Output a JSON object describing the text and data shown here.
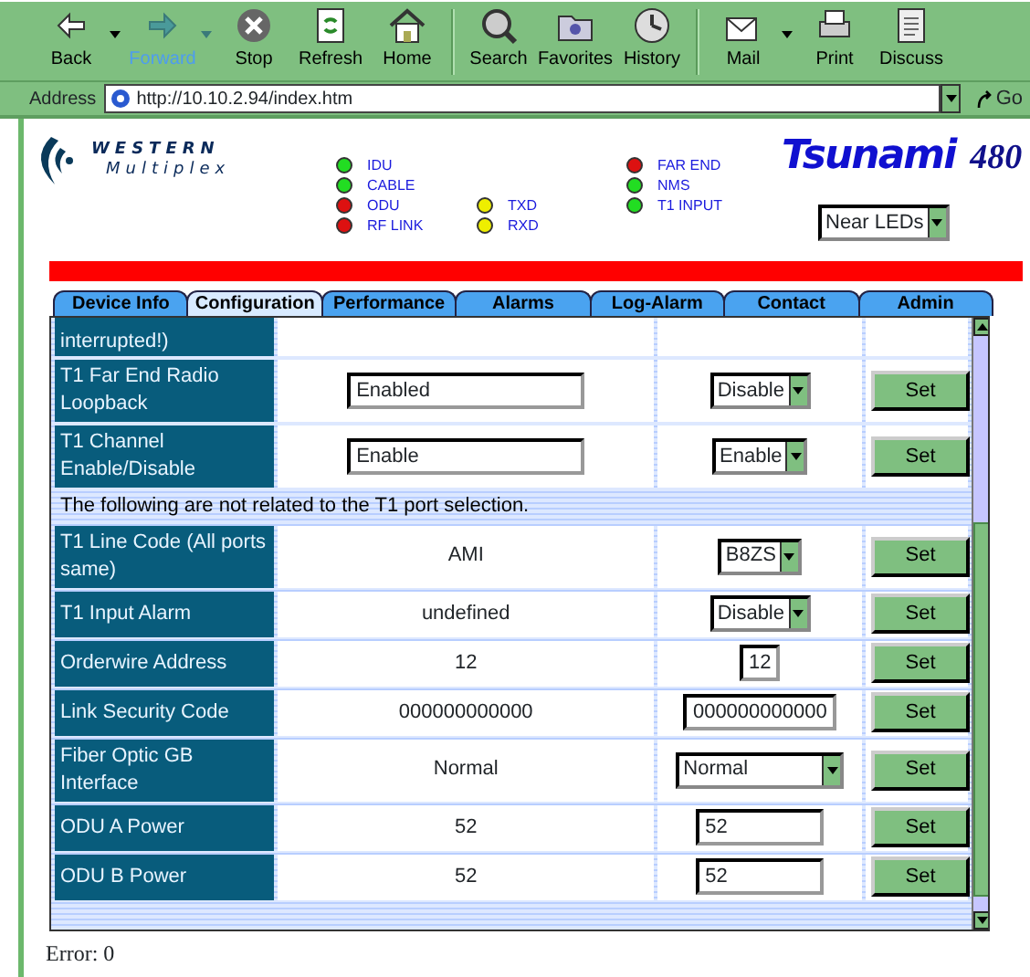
{
  "toolbar": [
    {
      "label": "Back",
      "disabled": false,
      "dropdown": true
    },
    {
      "label": "Forward",
      "disabled": true,
      "dropdown": true
    },
    {
      "label": "Stop",
      "disabled": false,
      "dropdown": false
    },
    {
      "label": "Refresh",
      "disabled": false,
      "dropdown": false
    },
    {
      "label": "Home",
      "disabled": false,
      "dropdown": false
    },
    {
      "label": "Search",
      "disabled": false,
      "dropdown": false
    },
    {
      "label": "Favorites",
      "disabled": false,
      "dropdown": false
    },
    {
      "label": "History",
      "disabled": false,
      "dropdown": false
    },
    {
      "label": "Mail",
      "disabled": false,
      "dropdown": true
    },
    {
      "label": "Print",
      "disabled": false,
      "dropdown": false
    },
    {
      "label": "Discuss",
      "disabled": false,
      "dropdown": false
    }
  ],
  "address_bar": {
    "label": "Address",
    "url": "http://10.10.2.94/index.htm",
    "go": "Go"
  },
  "logo": {
    "line_1": "WESTERN",
    "line_2": "Multiplex"
  },
  "product": {
    "name": "Tsunami",
    "model": "480"
  },
  "led_groups": [
    [
      {
        "label": "IDU",
        "color": "#22dd22"
      },
      {
        "label": "CABLE",
        "color": "#22dd22"
      },
      {
        "label": "ODU",
        "color": "#dd1111"
      },
      {
        "label": "RF LINK",
        "color": "#dd1111"
      }
    ],
    [
      {
        "label": "TXD",
        "color": "#eeee00"
      },
      {
        "label": "RXD",
        "color": "#eeee00"
      }
    ],
    [
      {
        "label": "FAR END",
        "color": "#dd1111"
      },
      {
        "label": "NMS",
        "color": "#22dd22"
      },
      {
        "label": "T1 INPUT",
        "color": "#22dd22"
      }
    ]
  ],
  "led_select": "Near LEDs",
  "tabs": [
    {
      "label": "Device Info",
      "selected": false
    },
    {
      "label": "Configuration",
      "selected": true
    },
    {
      "label": "Performance",
      "selected": false
    },
    {
      "label": "Alarms",
      "selected": false
    },
    {
      "label": "Log-Alarm",
      "selected": false
    },
    {
      "label": "Contact",
      "selected": false
    },
    {
      "label": "Admin",
      "selected": false
    }
  ],
  "rows": [
    {
      "kind": "partial",
      "label": "interrupted!)"
    },
    {
      "kind": "setting",
      "label": "T1 Far End Radio Loopback",
      "value": {
        "kind": "field",
        "text": "Enabled"
      },
      "control": {
        "kind": "select",
        "text": "Disable"
      },
      "button": "Set"
    },
    {
      "kind": "setting",
      "label": "T1 Channel Enable/Disable",
      "value": {
        "kind": "field",
        "text": "Enable"
      },
      "control": {
        "kind": "select",
        "text": "Enable"
      },
      "button": "Set"
    },
    {
      "kind": "note",
      "label": "The following are not related to the T1 port selection."
    },
    {
      "kind": "setting",
      "label": "T1 Line Code (All ports same)",
      "value": {
        "kind": "text",
        "text": "AMI"
      },
      "control": {
        "kind": "select",
        "text": "B8ZS"
      },
      "button": "Set"
    },
    {
      "kind": "setting",
      "label": "T1 Input Alarm",
      "value": {
        "kind": "text",
        "text": "undefined"
      },
      "control": {
        "kind": "select",
        "text": "Disable"
      },
      "button": "Set"
    },
    {
      "kind": "setting",
      "label": "Orderwire Address",
      "value": {
        "kind": "text",
        "text": "12"
      },
      "control": {
        "kind": "input",
        "text": "12"
      },
      "button": "Set"
    },
    {
      "kind": "setting",
      "label": "Link Security Code",
      "value": {
        "kind": "text",
        "text": "000000000000"
      },
      "control": {
        "kind": "input",
        "text": "000000000000"
      },
      "button": "Set"
    },
    {
      "kind": "setting",
      "label": "Fiber Optic GB Interface",
      "value": {
        "kind": "text",
        "text": "Normal"
      },
      "control": {
        "kind": "wideselect",
        "text": "Normal"
      },
      "button": "Set"
    },
    {
      "kind": "setting",
      "label": "ODU A Power",
      "value": {
        "kind": "text",
        "text": "52"
      },
      "control": {
        "kind": "wideinput",
        "text": "52"
      },
      "button": "Set"
    },
    {
      "kind": "setting",
      "label": "ODU B Power",
      "value": {
        "kind": "text",
        "text": "52"
      },
      "control": {
        "kind": "wideinput",
        "text": "52"
      },
      "button": "Set"
    }
  ],
  "status": "Error: 0"
}
